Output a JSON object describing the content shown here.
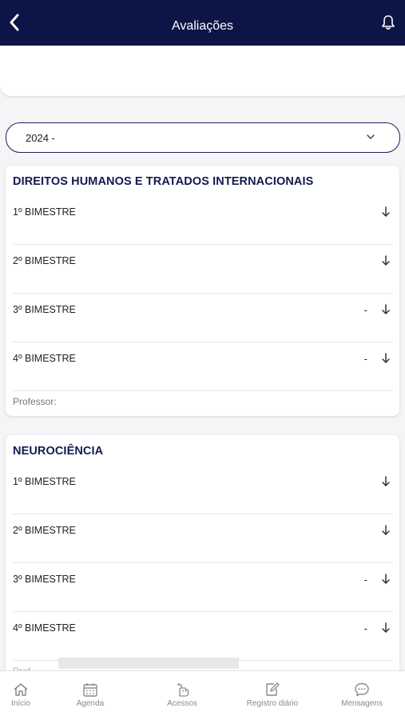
{
  "header": {
    "title": "Avaliações"
  },
  "year_select": {
    "value": "2024 -"
  },
  "cards": [
    {
      "subject": "DIREITOS HUMANOS E TRATADOS INTERNACIONAIS",
      "rows": [
        {
          "label": "1º BIMESTRE",
          "grade": ""
        },
        {
          "label": "2º BIMESTRE",
          "grade": ""
        },
        {
          "label": "3º BIMESTRE",
          "grade": "-"
        },
        {
          "label": "4º BIMESTRE",
          "grade": "-"
        }
      ],
      "professor": "Professor:"
    },
    {
      "subject": "NEUROCIÊNCIA",
      "rows": [
        {
          "label": "1º BIMESTRE",
          "grade": ""
        },
        {
          "label": "2º BIMESTRE",
          "grade": ""
        },
        {
          "label": "3º BIMESTRE",
          "grade": "-"
        },
        {
          "label": "4º BIMESTRE",
          "grade": "-"
        }
      ],
      "professor": "Prof"
    }
  ],
  "bottom_nav": [
    {
      "label": "Início",
      "icon": "home-icon"
    },
    {
      "label": "Agenda",
      "icon": "calendar-icon"
    },
    {
      "label": "Acessos",
      "icon": "hand-pointer-icon"
    },
    {
      "label": "Registro diário",
      "icon": "edit-icon"
    },
    {
      "label": "Mensagens",
      "icon": "chat-icon"
    }
  ],
  "colors": {
    "header_bg": "#0d1547",
    "accent": "#141a4f",
    "nav_text": "#8a8a8a"
  }
}
